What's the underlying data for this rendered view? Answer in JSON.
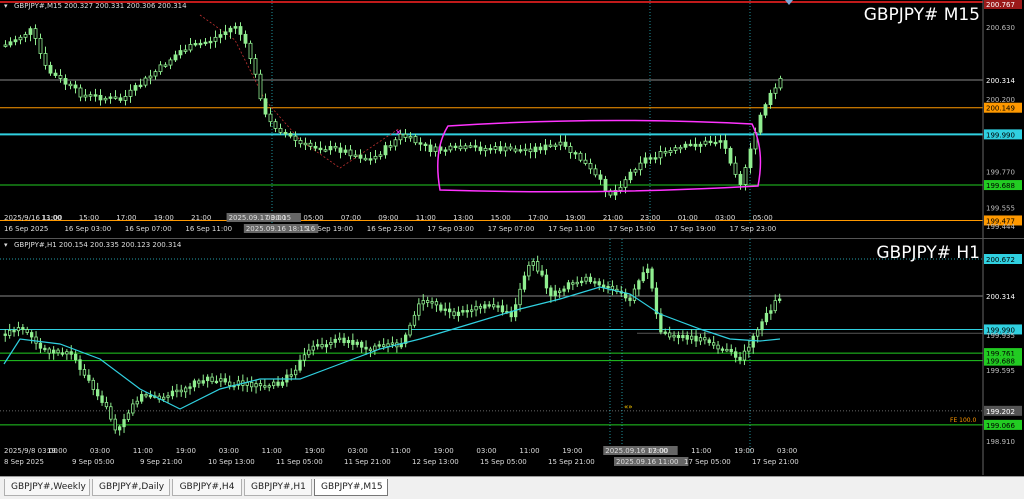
{
  "pane_m15": {
    "header": "GBPJPY#,M15  200.327 200.331 200.306 200.314",
    "title": "GBPJPY# M15",
    "price_labels": [
      {
        "text": "200.767",
        "bg": "#9a1a1a",
        "fg": "#ffffff",
        "value": 200.767
      },
      {
        "text": "200.630",
        "bg": "",
        "fg": "#bbbbbb",
        "value": 200.63
      },
      {
        "text": "200.314",
        "bg": "#000000",
        "fg": "#ffffff",
        "value": 200.314
      },
      {
        "text": "200.200",
        "bg": "",
        "fg": "#bbbbbb",
        "value": 200.2
      },
      {
        "text": "200.149",
        "bg": "#ff9900",
        "fg": "#000000",
        "value": 200.149
      },
      {
        "text": "199.990",
        "bg": "#30d0e0",
        "fg": "#000000",
        "value": 199.99
      },
      {
        "text": "199.770",
        "bg": "",
        "fg": "#bbbbbb",
        "value": 199.77
      },
      {
        "text": "199.688",
        "bg": "#22cc22",
        "fg": "#000000",
        "value": 199.688
      },
      {
        "text": "199.555",
        "bg": "",
        "fg": "#bbbbbb",
        "value": 199.555
      },
      {
        "text": "199.477",
        "bg": "#ff9900",
        "fg": "#000000",
        "value": 199.477
      },
      {
        "text": "199.444",
        "bg": "",
        "fg": "#bbbbbb",
        "value": 199.444
      }
    ],
    "time_row1": [
      "2025/9/16 11:00",
      "13:00",
      "15:00",
      "17:00",
      "19:00",
      "21:00",
      "2025.09.17 00:15",
      "03:00",
      "05:00",
      "07:00",
      "09:00",
      "11:00",
      "13:00",
      "15:00",
      "17:00",
      "19:00",
      "21:00",
      "23:00",
      "01:00",
      "03:00",
      "05:00"
    ],
    "time_row2": [
      "16 Sep 2025",
      "16 Sep 03:00",
      "16 Sep 07:00",
      "16 Sep 11:00",
      "2025.09.16 18:15",
      "16 Sep 19:00",
      "16 Sep 23:00",
      "17 Sep 03:00",
      "17 Sep 07:00",
      "17 Sep 11:00",
      "17 Sep 15:00",
      "17 Sep 19:00",
      "17 Sep 23:00"
    ]
  },
  "pane_h1": {
    "header": "GBPJPY#,H1  200.154 200.335 200.123 200.314",
    "title": "GBPJPY# H1",
    "price_labels": [
      {
        "text": "200.672",
        "bg": "#30d0e0",
        "fg": "#000000",
        "value": 200.672
      },
      {
        "text": "200.314",
        "bg": "#000000",
        "fg": "#ffffff",
        "value": 200.314
      },
      {
        "text": "199.990",
        "bg": "#30d0e0",
        "fg": "#000000",
        "value": 199.99
      },
      {
        "text": "199.935",
        "bg": "",
        "fg": "#bbbbbb",
        "value": 199.935
      },
      {
        "text": "199.761",
        "bg": "#22cc22",
        "fg": "#000000",
        "value": 199.761
      },
      {
        "text": "199.688",
        "bg": "#22cc22",
        "fg": "#000000",
        "value": 199.688
      },
      {
        "text": "199.595",
        "bg": "",
        "fg": "#bbbbbb",
        "value": 199.595
      },
      {
        "text": "199.202",
        "bg": "#555555",
        "fg": "#ffffff",
        "value": 199.202
      },
      {
        "text": "199.066",
        "bg": "#22cc22",
        "fg": "#000000",
        "value": 199.066
      },
      {
        "text": "198.910",
        "bg": "",
        "fg": "#bbbbbb",
        "value": 198.91
      }
    ],
    "fe_label": "FE 100.0",
    "time_row1": [
      "2025/9/8 03:00",
      "19:00",
      "03:00",
      "11:00",
      "19:00",
      "03:00",
      "11:00",
      "19:00",
      "03:00",
      "11:00",
      "19:00",
      "03:00",
      "11:00",
      "19:00",
      "2025.09.16 17:00",
      "03:00",
      "11:00",
      "19:00",
      "03:00"
    ],
    "time_row2": [
      "8 Sep 2025",
      "9 Sep 05:00",
      "9 Sep 21:00",
      "10 Sep 13:00",
      "11 Sep 05:00",
      "11 Sep 21:00",
      "12 Sep 13:00",
      "15 Sep 05:00",
      "15 Sep 21:00",
      "2025.09.16 11:00",
      "17 Sep 05:00",
      "17 Sep 21:00"
    ]
  },
  "tabs": [
    {
      "label": "GBPJPY#,Weekly",
      "active": false
    },
    {
      "label": "GBPJPY#,Daily",
      "active": false
    },
    {
      "label": "GBPJPY#,H4",
      "active": false
    },
    {
      "label": "GBPJPY#,H1",
      "active": false
    },
    {
      "label": "GBPJPY#,M15",
      "active": true
    }
  ],
  "colors": {
    "bull": "#90ee90",
    "line_cyan": "#30d0e0",
    "line_orange": "#ff9900",
    "line_green": "#22cc22",
    "rect": "#ff33ff",
    "grid": "#3a3a3a"
  }
}
